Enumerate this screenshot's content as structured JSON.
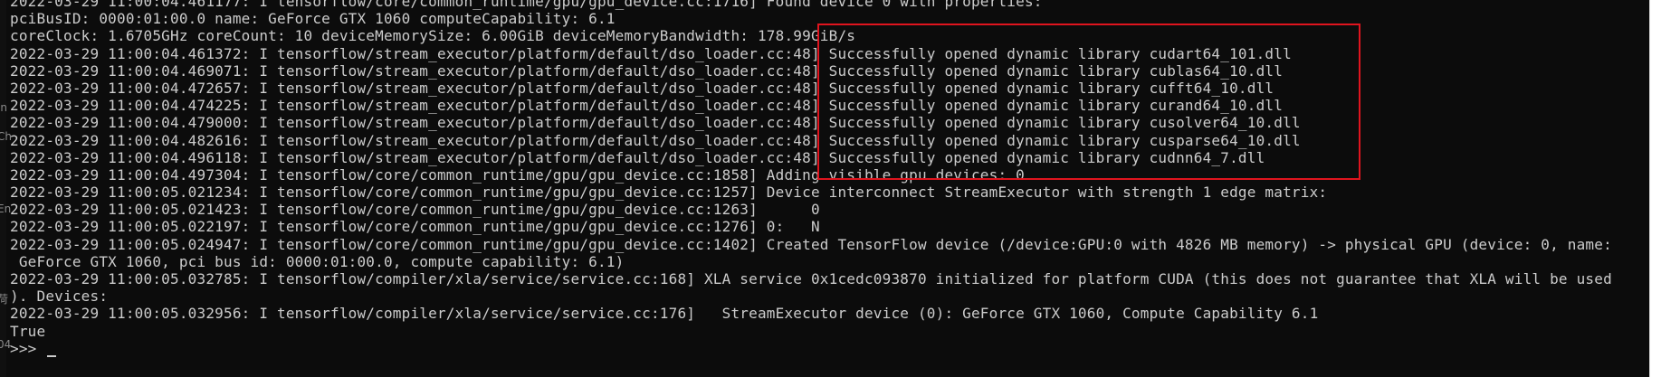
{
  "terminal": {
    "lines": [
      "2022-03-29 11:00:04.461177: I tensorflow/core/common_runtime/gpu/gpu_device.cc:1716] Found device 0 with properties:",
      "pciBusID: 0000:01:00.0 name: GeForce GTX 1060 computeCapability: 6.1",
      "coreClock: 1.6705GHz coreCount: 10 deviceMemorySize: 6.00GiB deviceMemoryBandwidth: 178.99GiB/s",
      "2022-03-29 11:00:04.461372: I tensorflow/stream_executor/platform/default/dso_loader.cc:48] Successfully opened dynamic library cudart64_101.dll",
      "2022-03-29 11:00:04.469071: I tensorflow/stream_executor/platform/default/dso_loader.cc:48] Successfully opened dynamic library cublas64_10.dll",
      "2022-03-29 11:00:04.472657: I tensorflow/stream_executor/platform/default/dso_loader.cc:48] Successfully opened dynamic library cufft64_10.dll",
      "2022-03-29 11:00:04.474225: I tensorflow/stream_executor/platform/default/dso_loader.cc:48] Successfully opened dynamic library curand64_10.dll",
      "2022-03-29 11:00:04.479000: I tensorflow/stream_executor/platform/default/dso_loader.cc:48] Successfully opened dynamic library cusolver64_10.dll",
      "2022-03-29 11:00:04.482616: I tensorflow/stream_executor/platform/default/dso_loader.cc:48] Successfully opened dynamic library cusparse64_10.dll",
      "2022-03-29 11:00:04.496118: I tensorflow/stream_executor/platform/default/dso_loader.cc:48] Successfully opened dynamic library cudnn64_7.dll",
      "2022-03-29 11:00:04.497304: I tensorflow/core/common_runtime/gpu/gpu_device.cc:1858] Adding visible gpu devices: 0",
      "2022-03-29 11:00:05.021234: I tensorflow/core/common_runtime/gpu/gpu_device.cc:1257] Device interconnect StreamExecutor with strength 1 edge matrix:",
      "2022-03-29 11:00:05.021423: I tensorflow/core/common_runtime/gpu/gpu_device.cc:1263]      0",
      "2022-03-29 11:00:05.022197: I tensorflow/core/common_runtime/gpu/gpu_device.cc:1276] 0:   N",
      "2022-03-29 11:00:05.024947: I tensorflow/core/common_runtime/gpu/gpu_device.cc:1402] Created TensorFlow device (/device:GPU:0 with 4826 MB memory) -> physical GPU (device: 0, name:",
      " GeForce GTX 1060, pci bus id: 0000:01:00.0, compute capability: 6.1)",
      "2022-03-29 11:00:05.032785: I tensorflow/compiler/xla/service/service.cc:168] XLA service 0x1cedc093870 initialized for platform CUDA (this does not guarantee that XLA will be used",
      "). Devices:",
      "2022-03-29 11:00:05.032956: I tensorflow/compiler/xla/service/service.cc:176]   StreamExecutor device (0): GeForce GTX 1060, Compute Capability 6.1",
      "True",
      ">>> "
    ]
  },
  "left_strip": {
    "glyphs": [
      "in",
      "Ch",
      "En",
      "荷",
      "04"
    ]
  },
  "colors": {
    "background": "#0c0c0c",
    "text": "#cccccc",
    "highlight": "#e0141e"
  }
}
